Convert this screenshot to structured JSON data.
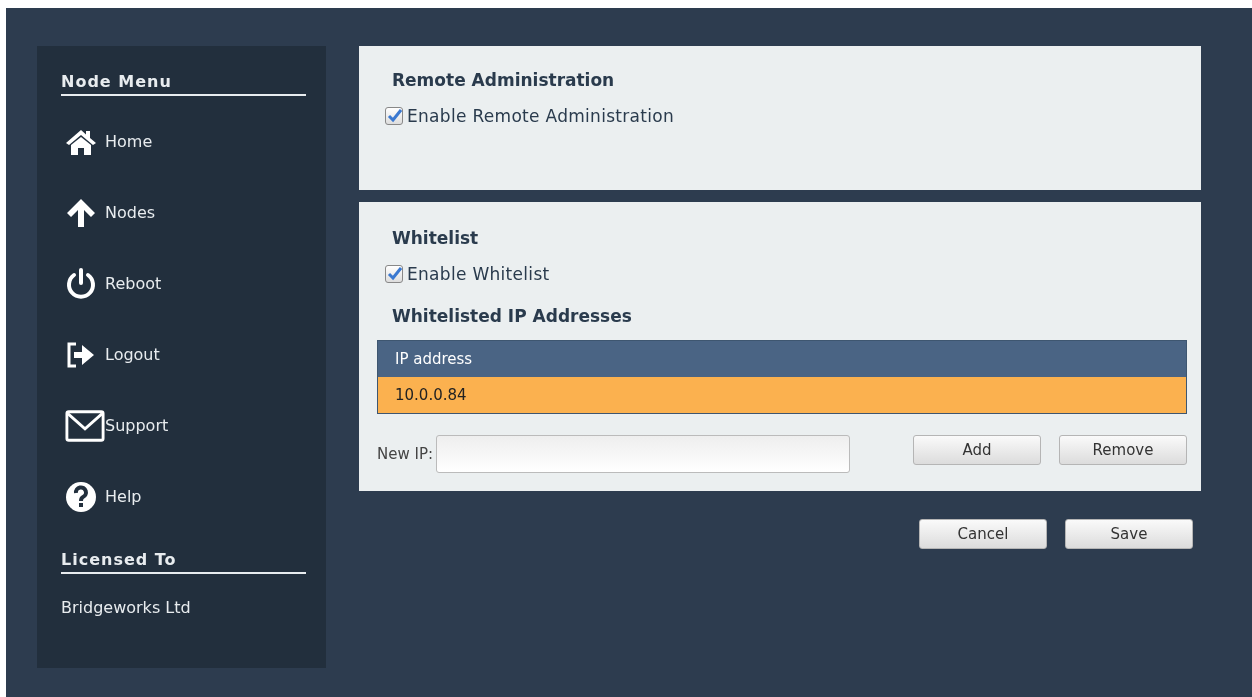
{
  "sidebar": {
    "title": "Node Menu",
    "items": [
      {
        "label": "Home"
      },
      {
        "label": "Nodes"
      },
      {
        "label": "Reboot"
      },
      {
        "label": "Logout"
      },
      {
        "label": "Support"
      },
      {
        "label": "Help"
      }
    ],
    "license_title": "Licensed To",
    "licensee": "Bridgeworks Ltd"
  },
  "remote_admin": {
    "heading": "Remote Administration",
    "checkbox": {
      "label": "Enable Remote Administration",
      "checked": true
    }
  },
  "whitelist": {
    "heading": "Whitelist",
    "checkbox": {
      "label": "Enable Whitelist",
      "checked": true
    },
    "list_heading": "Whitelisted IP Addresses",
    "table": {
      "columns": [
        "IP address"
      ],
      "rows": [
        {
          "cells": [
            "10.0.0.84"
          ],
          "selected": true
        }
      ]
    },
    "new_ip": {
      "label": "New IP:"
    },
    "buttons": [
      "Add",
      "Remove"
    ]
  },
  "buttons": [
    "Cancel",
    "Save"
  ]
}
